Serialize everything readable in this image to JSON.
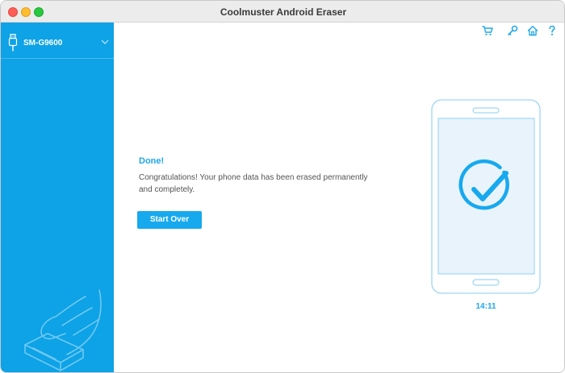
{
  "window": {
    "title": "Coolmuster Android Eraser"
  },
  "sidebar": {
    "device_name": "SM-G9600",
    "device_icon": "usb-icon",
    "dropdown_icon": "chevron-down-icon"
  },
  "toolbar": {
    "icons": [
      "cart-icon",
      "key-icon",
      "home-icon",
      "help-icon"
    ]
  },
  "main": {
    "status_title": "Done!",
    "status_message": "Congratulations! Your phone data has been erased permanently and completely.",
    "start_over_label": "Start Over",
    "phone_time": "14:11"
  },
  "colors": {
    "accent": "#17a9ee",
    "sidebar_bg": "#0ea2e6",
    "title_bar": "#ececec",
    "phone_screen": "#e9f3fc"
  }
}
